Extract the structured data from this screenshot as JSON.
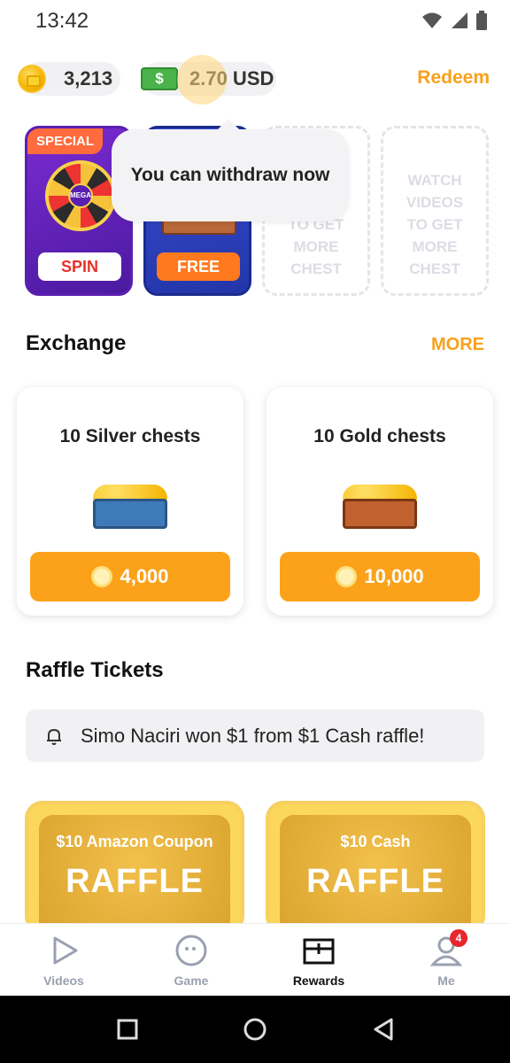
{
  "status_bar": {
    "time": "13:42"
  },
  "balances": {
    "coins": "3,213",
    "cash": "2.70 USD",
    "cash_icon": "$",
    "redeem_label": "Redeem"
  },
  "chests": {
    "special": {
      "tag": "SPECIAL",
      "wheel_label": "MEGA",
      "button": "SPIN"
    },
    "free": {
      "button": "FREE"
    },
    "empty_1": {
      "text": "WATCH VIDEOS TO GET MORE CHEST"
    },
    "empty_2": {
      "text": "WATCH VIDEOS TO GET MORE CHEST"
    }
  },
  "tooltip": {
    "message": "You can withdraw now"
  },
  "exchange": {
    "title": "Exchange",
    "more_label": "MORE",
    "items": [
      {
        "name": "10 Silver chests",
        "price": "4,000"
      },
      {
        "name": "10 Gold chests",
        "price": "10,000"
      }
    ]
  },
  "raffle": {
    "title": "Raffle Tickets",
    "notice": "Simo Naciri won $1 from $1 Cash raffle!",
    "items": [
      {
        "prize": "$10 Amazon Coupon",
        "label": "RAFFLE"
      },
      {
        "prize": "$10 Cash",
        "label": "RAFFLE"
      }
    ]
  },
  "tabs": [
    {
      "label": "Videos",
      "icon": "play-icon"
    },
    {
      "label": "Game",
      "icon": "game-icon"
    },
    {
      "label": "Rewards",
      "icon": "rewards-icon",
      "active": true
    },
    {
      "label": "Me",
      "icon": "profile-icon",
      "badge": "4"
    }
  ],
  "colors": {
    "accent": "#F7A11A",
    "button": "#FBA21A"
  }
}
